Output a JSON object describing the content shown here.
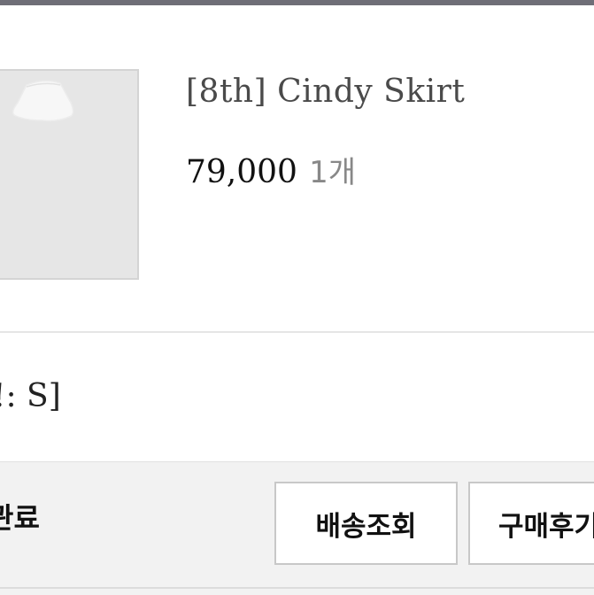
{
  "product": {
    "name": "[8th] Cindy Skirt",
    "price": "79,000",
    "quantity": "1개",
    "option": "!: S]",
    "thumbnail_icon": "skirt-image"
  },
  "order": {
    "status": "관료",
    "buttons": {
      "track": "배송조회",
      "review": "구매후기"
    }
  },
  "colors": {
    "top_bar": "#6f6e77",
    "action_bar_bg": "#f2f2f2"
  }
}
